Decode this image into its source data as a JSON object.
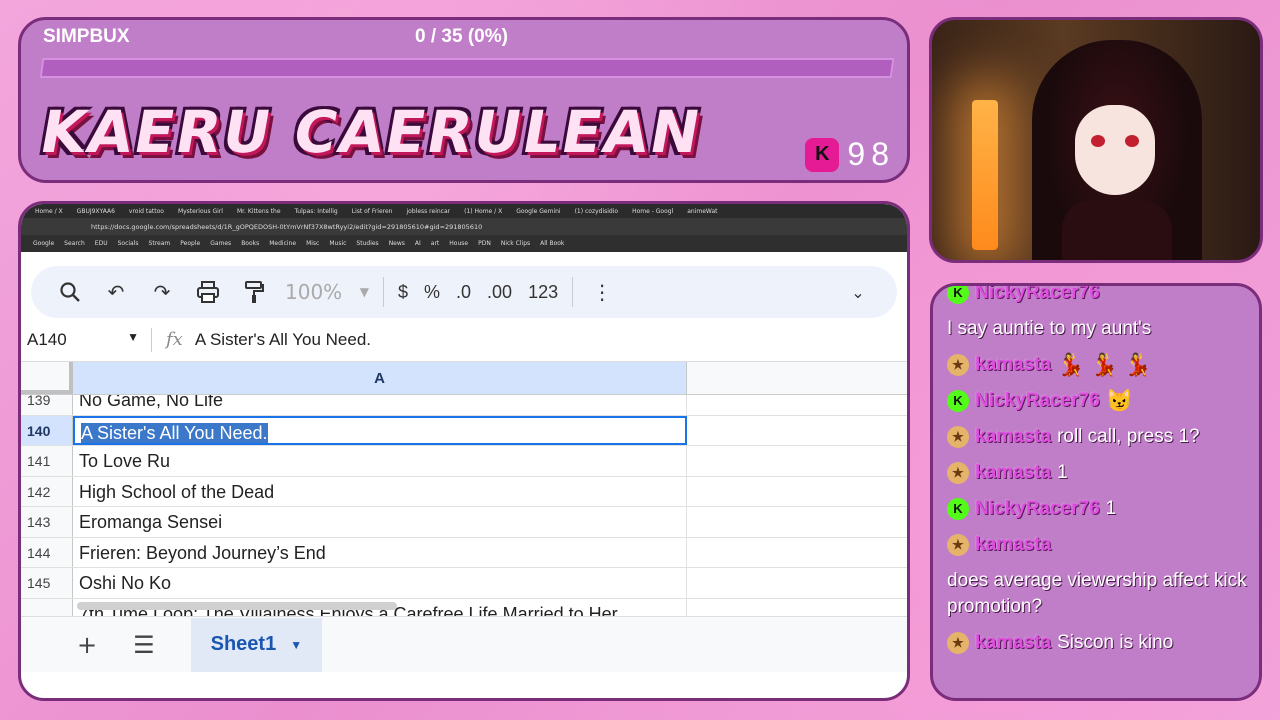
{
  "overlay": {
    "goal_label": "SIMPBUX",
    "goal_progress": "0 / 35 (0%)",
    "goal_fraction": 0,
    "streamer_name": "KAERU CAERULEAN",
    "kick_badge": "K",
    "count": "98"
  },
  "browser": {
    "tabs": [
      "Home / X",
      "GBUJ9XYAA6",
      "vroid tattoo",
      "Mysterious Girl",
      "Mr. Kittens the",
      "Tulpas: Intellig",
      "List of Frieren",
      "jobless reincar",
      "(1) Home / X",
      "Google Gemini",
      "(1) cozydisidio",
      "Home - Googl",
      "animeWat"
    ],
    "url": "https://docs.google.com/spreadsheets/d/1R_gOPQEDOSH-0tYmVrNf37X8wtRyyi2/edit?gid=291805610#gid=291805610",
    "bookmarks": [
      "Google",
      "Search",
      "EDU",
      "Socials",
      "Stream",
      "People",
      "Games",
      "Books",
      "Medicine",
      "Misc",
      "Music",
      "Studies",
      "News",
      "AI",
      "art",
      "House",
      "PDN",
      "Nick Clips",
      "All Book"
    ]
  },
  "sheet": {
    "toolbar": {
      "zoom": "100%",
      "currency": "$",
      "percent": "%",
      "dec_decrease": ".0",
      "dec_increase": ".00",
      "format_123": "123"
    },
    "cell_ref": "A140",
    "fx": "fx",
    "formula_value": "A Sister's All You Need.",
    "column_a": "A",
    "rows": [
      {
        "num": "139",
        "value": "No Game, No Life"
      },
      {
        "num": "140",
        "value": "A Sister's All You Need."
      },
      {
        "num": "141",
        "value": "To Love Ru"
      },
      {
        "num": "142",
        "value": "High School of the Dead"
      },
      {
        "num": "143",
        "value": "Eromanga Sensei"
      },
      {
        "num": "144",
        "value": "Frieren: Beyond Journey’s End"
      },
      {
        "num": "145",
        "value": "Oshi No Ko"
      },
      {
        "num": "",
        "value": "7th Time Loop: The Villainess Enjoys a Carefree Life Married to Her"
      }
    ],
    "sheet_tab": "Sheet1"
  },
  "chat": [
    {
      "badge": "kick",
      "user": "NickyRacer76",
      "text": ""
    },
    {
      "badge": "",
      "user": "",
      "text": "I say auntie to my aunt's"
    },
    {
      "badge": "gift",
      "user": "kamasta",
      "text": "",
      "emotes": "💃 💃 💃"
    },
    {
      "badge": "kick",
      "user": "NickyRacer76",
      "text": "",
      "emotes": "😼"
    },
    {
      "badge": "gift",
      "user": "kamasta",
      "text": "roll call, press 1?"
    },
    {
      "badge": "gift",
      "user": "kamasta",
      "text": "1"
    },
    {
      "badge": "kick",
      "user": "NickyRacer76",
      "text": "1"
    },
    {
      "badge": "gift",
      "user": "kamasta",
      "text": ""
    },
    {
      "badge": "",
      "user": "",
      "text": "does average viewership affect kick promotion?"
    },
    {
      "badge": "gift",
      "user": "kamasta",
      "text": "Siscon is kino"
    }
  ]
}
